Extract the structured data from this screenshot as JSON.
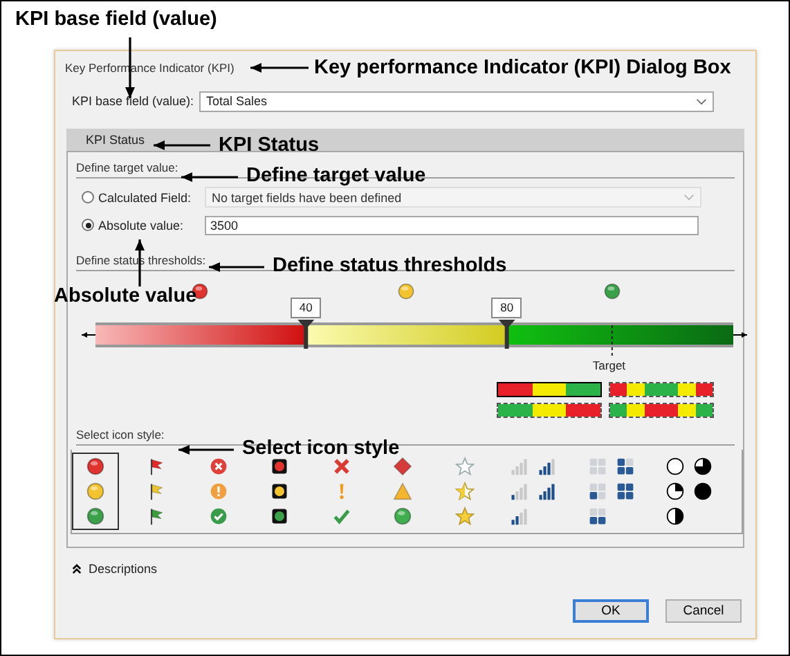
{
  "annotations": [
    {
      "text": "KPI base field (value)"
    },
    {
      "text": "Key performance Indicator (KPI) Dialog Box"
    },
    {
      "text": "KPI Status"
    },
    {
      "text": "Define target value"
    },
    {
      "text": "Define status thresholds"
    },
    {
      "text": "Absolute value"
    },
    {
      "text": "Select icon style"
    }
  ],
  "dialog": {
    "title": "Key Performance Indicator (KPI)",
    "base_field": {
      "label": "KPI base field (value):",
      "value": "Total Sales"
    },
    "section_title": "KPI Status",
    "target": {
      "heading": "Define target value:",
      "options": [
        {
          "label": "Calculated Field:",
          "selected": false,
          "kind": "dropdown",
          "value": "No target fields have been defined",
          "disabled": true
        },
        {
          "label": "Absolute value:",
          "selected": true,
          "kind": "text",
          "value": "3500",
          "disabled": false
        }
      ]
    },
    "thresholds": {
      "heading": "Define status thresholds:",
      "markers": [
        {
          "label": "40",
          "level": 0.33
        },
        {
          "label": "80",
          "level": 0.645
        }
      ],
      "target_label": "Target",
      "band_styles": [
        {
          "kind": "rising",
          "selected": true
        },
        {
          "kind": "peak",
          "selected": false
        },
        {
          "kind": "falling",
          "selected": false
        },
        {
          "kind": "valley",
          "selected": false
        }
      ]
    },
    "icon_style": {
      "heading": "Select icon style:",
      "sets": [
        {
          "kind": "circles",
          "selected": true
        },
        {
          "kind": "flags",
          "selected": false
        },
        {
          "kind": "circled-symbols",
          "selected": false
        },
        {
          "kind": "traffic-lights",
          "selected": false
        },
        {
          "kind": "symbols",
          "selected": false
        },
        {
          "kind": "shapes",
          "selected": false
        },
        {
          "kind": "stars",
          "selected": false
        },
        {
          "kind": "bars",
          "selected": false
        },
        {
          "kind": "boxes",
          "selected": false
        },
        {
          "kind": "quarters",
          "selected": false
        }
      ]
    },
    "descriptions": "Descriptions",
    "buttons": [
      {
        "label": "OK",
        "default": true
      },
      {
        "label": "Cancel",
        "default": false
      }
    ]
  }
}
